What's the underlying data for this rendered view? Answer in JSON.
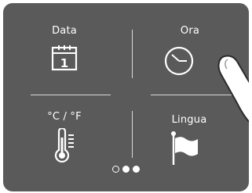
{
  "tiles": {
    "date": {
      "label": "Data",
      "icon": "calendar-icon",
      "day": "1"
    },
    "time": {
      "label": "Ora",
      "icon": "clock-icon"
    },
    "units": {
      "label": "°C / °F",
      "icon": "thermometer-icon"
    },
    "language": {
      "label": "Lingua",
      "icon": "flag-icon"
    }
  },
  "pager": {
    "pages": 3,
    "active": [
      2,
      3
    ]
  },
  "colors": {
    "background": "#5a5a5a",
    "foreground": "#ffffff",
    "divider": "#d8d8d8"
  }
}
